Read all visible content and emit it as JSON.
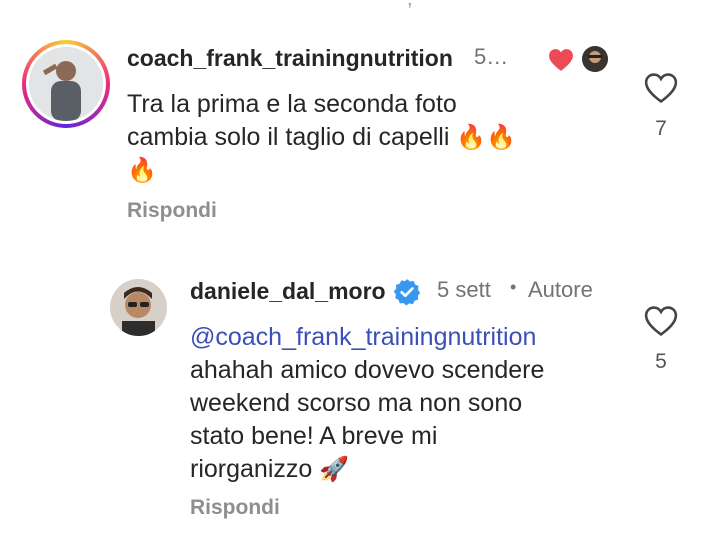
{
  "top_fragment": ",",
  "comments": [
    {
      "username": "coach_frank_trainingnutrition",
      "time": "5…",
      "text_line1": "Tra la prima e la seconda foto",
      "text_line2": "cambia solo il taglio di capelli",
      "emoji_inline": "🔥🔥",
      "emoji_next": "🔥",
      "reply_label": "Rispondi",
      "like_count": "7",
      "liked_by_author_icon": "heart-icon"
    },
    {
      "username": "daniele_dal_moro",
      "time": "5 sett",
      "author_tag": "Autore",
      "dot": "•",
      "mention": "@coach_frank_trainingnutrition",
      "line1": "ahahah amico dovevo scendere",
      "line2": "weekend scorso ma non sono",
      "line3": "stato bene! A breve mi",
      "line4": "riorganizzo",
      "emoji": "🚀",
      "reply_label": "Rispondi",
      "like_count": "5"
    }
  ],
  "colors": {
    "mention": "#3b4fb8",
    "like_red": "#ed4956",
    "verified_blue": "#3897f0",
    "meta_gray": "#737373"
  }
}
